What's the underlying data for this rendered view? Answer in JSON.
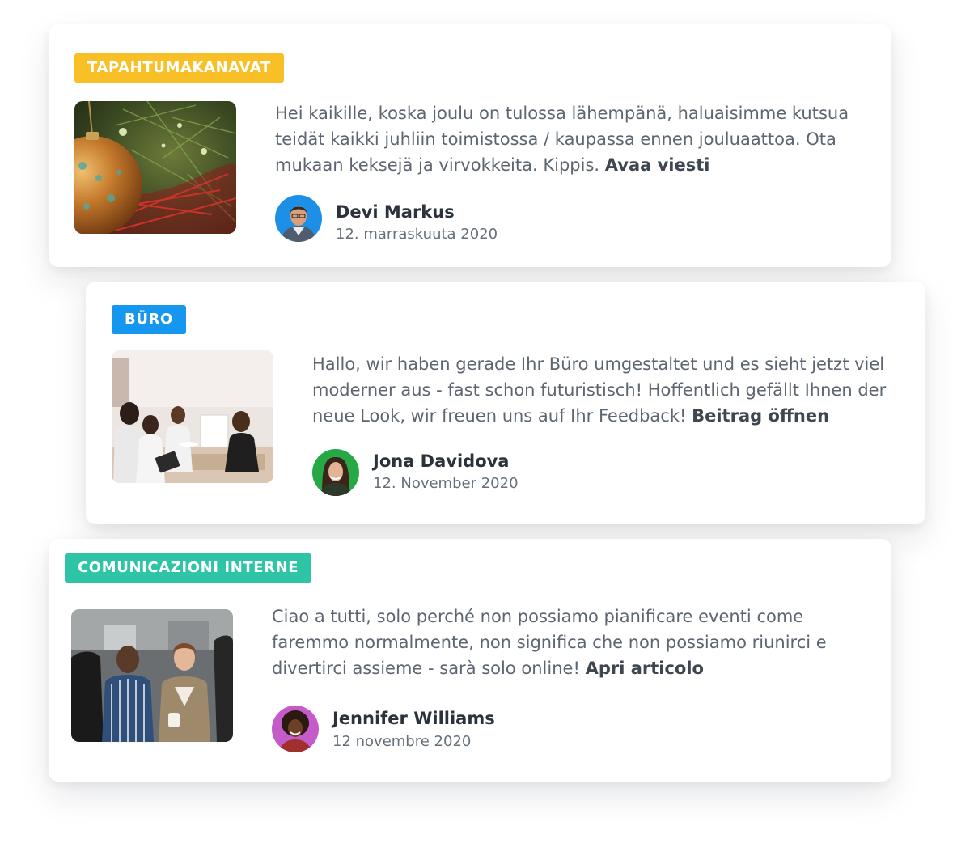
{
  "colors": {
    "badge_yellow": "#f8bf26",
    "badge_blue": "#1597f0",
    "badge_teal": "#2ec4a6",
    "text_body": "#5d6670",
    "text_name": "#2b323b"
  },
  "posts": [
    {
      "channel": "TAPAHTUMAKANAVAT",
      "channel_color": "#f8bf26",
      "image": "christmas-ornament-image",
      "message": "Hei kaikille, koska joulu on tulossa lähempänä, haluaisimme kutsua teidät kaikki juhliin toimistossa / kaupassa ennen jouluaattoa. Ota mukaan keksejä ja virvokkeita. Kippis.",
      "link": "Avaa viesti",
      "author": "Devi Markus",
      "date": "12. marraskuuta 2020"
    },
    {
      "channel": "BÜRO",
      "channel_color": "#1597f0",
      "image": "office-meeting-image",
      "message": "Hallo, wir haben gerade Ihr Büro umgestaltet und es sieht jetzt viel moderner aus - fast schon futuristisch! Hoffentlich gefällt Ihnen der neue Look, wir freuen uns auf Ihr Feedback!",
      "link": "Beitrag öffnen",
      "author": "Jona Davidova",
      "date": "12. November 2020"
    },
    {
      "channel": "COMUNICAZIONI INTERNE",
      "channel_color": "#2ec4a6",
      "image": "team-event-image",
      "message": "Ciao a tutti, solo perché non possiamo pianificare eventi come faremmo normalmente, non significa che non possiamo riunirci e divertirci assieme - sarà solo online!",
      "link": "Apri articolo",
      "author": "Jennifer Williams",
      "date": "12 novembre 2020"
    }
  ]
}
